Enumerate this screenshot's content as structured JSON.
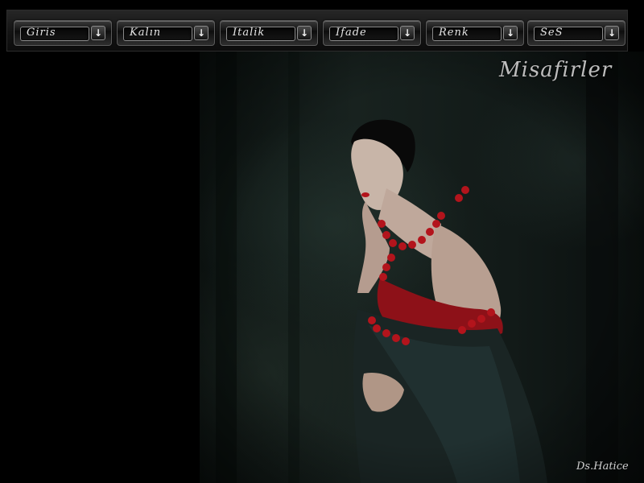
{
  "toolbar": {
    "buttons": [
      {
        "label": "Giris"
      },
      {
        "label": "Kalın"
      },
      {
        "label": "Italik"
      },
      {
        "label": "Ifade"
      },
      {
        "label": "Renk"
      },
      {
        "label": "SeS"
      }
    ],
    "dropdown_icon": "down-arrow-icon"
  },
  "header": {
    "title": "Misafirler"
  },
  "footer": {
    "signature": "Ds.Hatice"
  },
  "photo": {
    "icon": "woman-portrait-photo"
  },
  "colors": {
    "background": "#000000",
    "toolbar": "#141414",
    "label": "#e6e6e6",
    "title": "#bdbdbd",
    "accent_red": "#b3141c"
  }
}
